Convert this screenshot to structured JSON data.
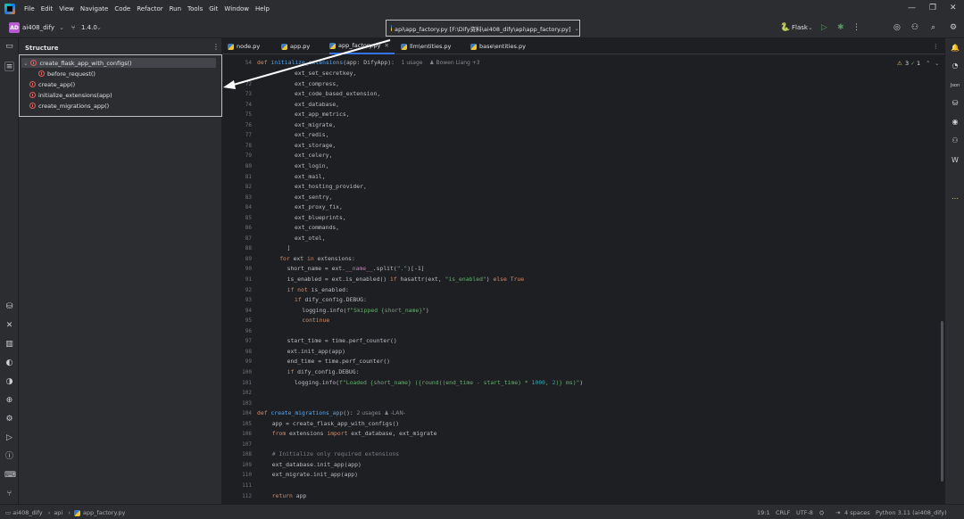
{
  "menubar": {
    "items": [
      "File",
      "Edit",
      "View",
      "Navigate",
      "Code",
      "Refactor",
      "Run",
      "Tools",
      "Git",
      "Window",
      "Help"
    ]
  },
  "toolbar": {
    "project_badge": "AD",
    "project_name": "ai408_dify",
    "branch": "1.4.0",
    "path": "api\\app_factory.py [F:\\Dify资料\\ai408_dify\\api\\app_factory.py]",
    "run_config": "Flask"
  },
  "structure": {
    "title": "Structure",
    "items": [
      {
        "label": "create_flask_app_with_configs()",
        "indent": 0,
        "selected": true
      },
      {
        "label": "before_request()",
        "indent": 1,
        "selected": false
      },
      {
        "label": "create_app()",
        "indent": 0,
        "selected": false
      },
      {
        "label": "initialize_extensions(app)",
        "indent": 0,
        "selected": false
      },
      {
        "label": "create_migrations_app()",
        "indent": 0,
        "selected": false
      }
    ]
  },
  "tabs": [
    {
      "label": "node.py",
      "active": false
    },
    {
      "label": "app.py",
      "active": false
    },
    {
      "label": "app_factory.py",
      "active": true
    },
    {
      "label": "llm\\entities.py",
      "active": false
    },
    {
      "label": "base\\entities.py",
      "active": false
    }
  ],
  "editor": {
    "warnings": "3",
    "checks": "1",
    "header_line": "54",
    "header_hint": "1 usage",
    "header_author": "Bowen Liang +3",
    "lines": [
      {
        "n": "",
        "t": "ext_set_secretkey,"
      },
      {
        "n": "72",
        "t": "ext_compress,"
      },
      {
        "n": "73",
        "t": "ext_code_based_extension,"
      },
      {
        "n": "74",
        "t": "ext_database,"
      },
      {
        "n": "75",
        "t": "ext_app_metrics,"
      },
      {
        "n": "76",
        "t": "ext_migrate,"
      },
      {
        "n": "77",
        "t": "ext_redis,"
      },
      {
        "n": "78",
        "t": "ext_storage,"
      },
      {
        "n": "79",
        "t": "ext_celery,"
      },
      {
        "n": "80",
        "t": "ext_login,"
      },
      {
        "n": "81",
        "t": "ext_mail,"
      },
      {
        "n": "82",
        "t": "ext_hosting_provider,"
      },
      {
        "n": "83",
        "t": "ext_sentry,"
      },
      {
        "n": "84",
        "t": "ext_proxy_fix,"
      },
      {
        "n": "85",
        "t": "ext_blueprints,"
      },
      {
        "n": "86",
        "t": "ext_commands,"
      },
      {
        "n": "87",
        "t": "ext_otel,"
      },
      {
        "n": "88",
        "t": "]"
      },
      {
        "n": "89",
        "t": "for ext in extensions:"
      },
      {
        "n": "90",
        "t": "short_name = ext.__name__.split(\".\")[-1]"
      },
      {
        "n": "91",
        "t": "is_enabled = ext.is_enabled() if hasattr(ext, \"is_enabled\") else True"
      },
      {
        "n": "92",
        "t": "if not is_enabled:"
      },
      {
        "n": "93",
        "t": "if dify_config.DEBUG:"
      },
      {
        "n": "94",
        "t": "logging.info(f\"Skipped {short_name}\")"
      },
      {
        "n": "95",
        "t": "continue"
      },
      {
        "n": "96",
        "t": ""
      },
      {
        "n": "97",
        "t": "start_time = time.perf_counter()"
      },
      {
        "n": "98",
        "t": "ext.init_app(app)"
      },
      {
        "n": "99",
        "t": "end_time = time.perf_counter()"
      },
      {
        "n": "100",
        "t": "if dify_config.DEBUG:"
      },
      {
        "n": "101",
        "t": "logging.info(f\"Loaded {short_name} ({round((end_time - start_time) * 1000, 2)} ms)\")"
      },
      {
        "n": "102",
        "t": ""
      },
      {
        "n": "103",
        "t": ""
      },
      {
        "n": "104",
        "t": "def create_migrations_app():"
      },
      {
        "n": "105",
        "t": "app = create_flask_app_with_configs()"
      },
      {
        "n": "106",
        "t": "from extensions import ext_database, ext_migrate"
      },
      {
        "n": "107",
        "t": ""
      },
      {
        "n": "108",
        "t": "# Initialize only required extensions"
      },
      {
        "n": "109",
        "t": "ext_database.init_app(app)"
      },
      {
        "n": "110",
        "t": "ext_migrate.init_app(app)"
      },
      {
        "n": "111",
        "t": ""
      },
      {
        "n": "112",
        "t": "return app"
      }
    ],
    "migrations_hint": "2 usages",
    "migrations_author": "-LAN-"
  },
  "statusbar": {
    "crumbs": [
      "ai408_dify",
      "api",
      "app_factory.py"
    ],
    "position": "19:1",
    "line_sep": "CRLF",
    "encoding": "UTF-8",
    "indent": "4 spaces",
    "interpreter": "Python 3.11 (ai408_dify)"
  },
  "colors": {
    "accent": "#3574f0",
    "keyword": "#cf8e6d",
    "function": "#56a8f5",
    "string": "#6aab73"
  }
}
